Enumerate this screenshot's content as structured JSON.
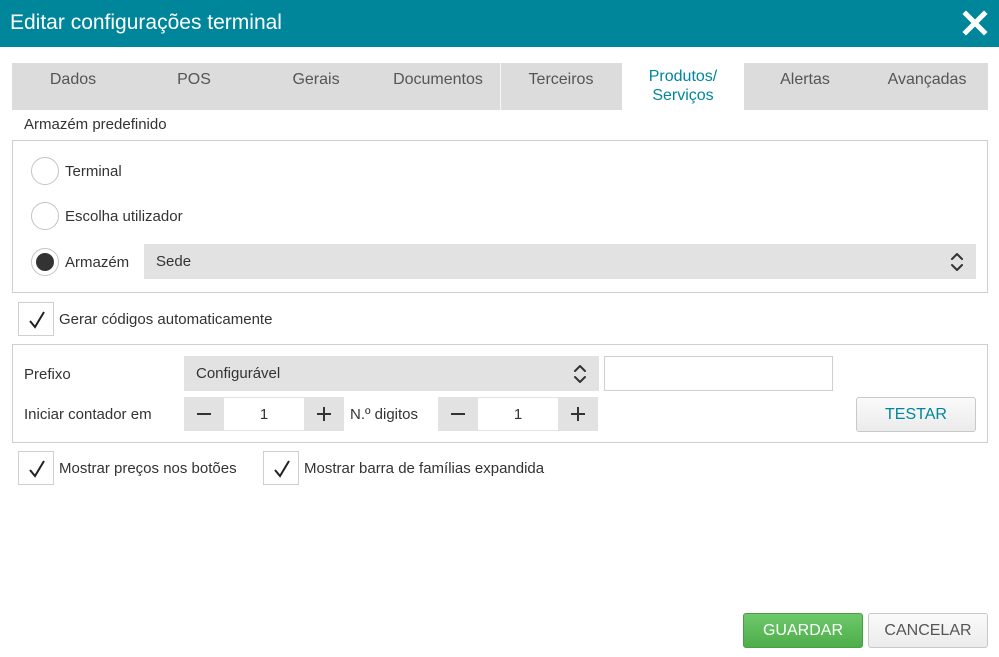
{
  "window": {
    "title": "Editar configurações terminal",
    "close_icon": "close-icon"
  },
  "tabs": [
    {
      "label": "Dados"
    },
    {
      "label": "POS"
    },
    {
      "label": "Gerais"
    },
    {
      "label": "Documentos"
    },
    {
      "label": "Terceiros"
    },
    {
      "label": "Produtos/\nServiços",
      "active": true
    },
    {
      "label": "Alertas"
    },
    {
      "label": "Avançadas"
    }
  ],
  "warehouse": {
    "section_label": "Armazém predefinido",
    "options": [
      {
        "label": "Terminal",
        "checked": false
      },
      {
        "label": "Escolha utilizador",
        "checked": false
      },
      {
        "label": "Armazém",
        "checked": true
      }
    ],
    "select_value": "Sede"
  },
  "auto_codes": {
    "label": "Gerar códigos automaticamente",
    "checked": true
  },
  "codes": {
    "prefix_label": "Prefixo",
    "prefix_select": "Configurável",
    "prefix_input_value": "",
    "counter_label": "Iniciar contador em",
    "counter_value": "1",
    "digits_label": "N.º digitos",
    "digits_value": "1",
    "test_button": "TESTAR"
  },
  "options": {
    "show_prices_label": "Mostrar preços nos botões",
    "show_prices_checked": true,
    "show_families_label": "Mostrar barra de famílias expandida",
    "show_families_checked": true
  },
  "footer": {
    "save_button": "GUARDAR",
    "cancel_button": "CANCELAR"
  },
  "colors": {
    "accent": "#00869b",
    "save": "#5cb85c"
  }
}
